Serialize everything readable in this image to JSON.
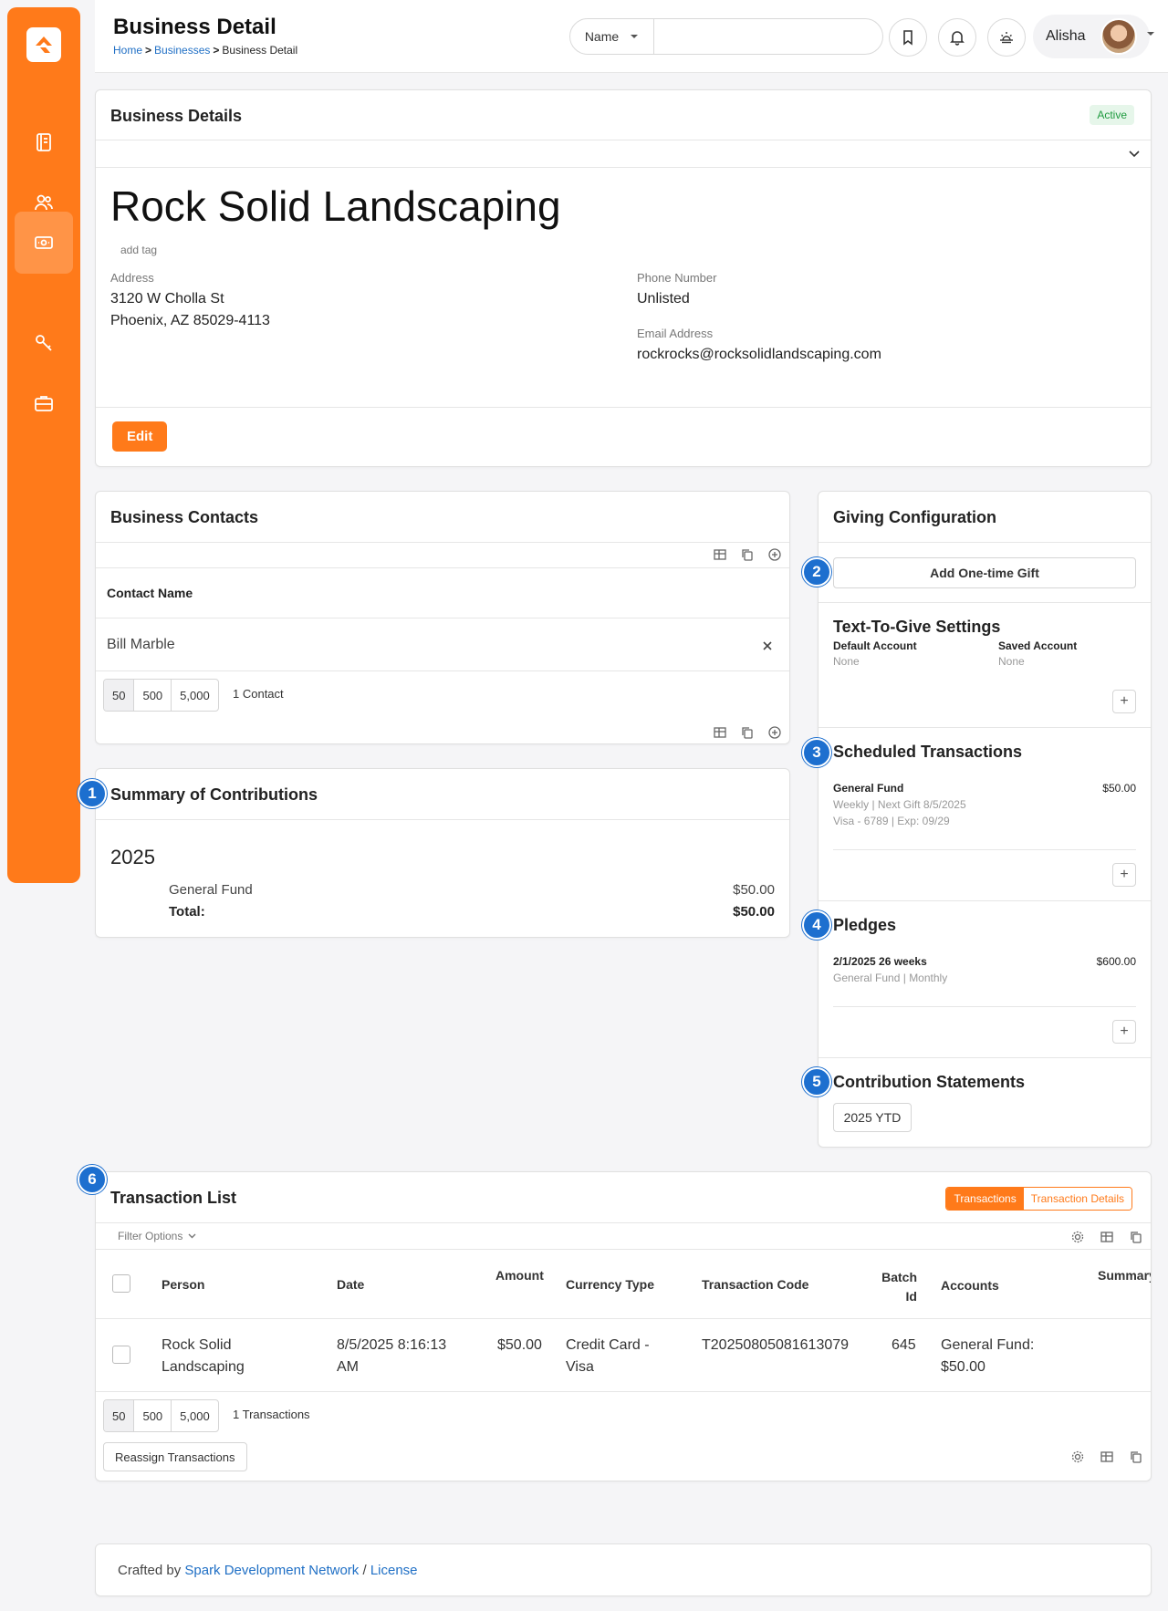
{
  "header": {
    "title": "Business Detail",
    "breadcrumb": [
      "Home",
      "Businesses",
      "Business Detail"
    ],
    "search_scope": "Name",
    "search_value": "",
    "user_name": "Alisha"
  },
  "business": {
    "card_title": "Business Details",
    "status": "Active",
    "name": "Rock Solid Landscaping",
    "add_tag": "add tag",
    "address_label": "Address",
    "address_line1": "3120 W Cholla St",
    "address_line2": "Phoenix, AZ 85029-4113",
    "phone_label": "Phone Number",
    "phone_value": "Unlisted",
    "email_label": "Email Address",
    "email_value": "rockrocks@rocksolidlandscaping.com",
    "edit_label": "Edit"
  },
  "contacts": {
    "title": "Business Contacts",
    "column": "Contact Name",
    "rows": [
      {
        "name": "Bill Marble"
      }
    ],
    "pager": [
      "50",
      "500",
      "5,000"
    ],
    "count": "1 Contact"
  },
  "summary": {
    "title": "Summary of Contributions",
    "year": "2025",
    "fund": "General Fund",
    "fund_amount": "$50.00",
    "total_label": "Total:",
    "total_amount": "$50.00"
  },
  "giving": {
    "title": "Giving Configuration",
    "add_gift": "Add One-time Gift",
    "ttg_title": "Text-To-Give Settings",
    "default_account_label": "Default Account",
    "default_account_value": "None",
    "saved_account_label": "Saved Account",
    "saved_account_value": "None",
    "scheduled_title": "Scheduled Transactions",
    "scheduled_fund": "General Fund",
    "scheduled_amount": "$50.00",
    "scheduled_freq": "Weekly",
    "scheduled_next": "Next Gift 8/5/2025",
    "scheduled_card": "Visa - 6789",
    "scheduled_exp": "Exp: 09/29",
    "pledges_title": "Pledges",
    "pledge_desc": "2/1/2025 26 weeks",
    "pledge_amount": "$600.00",
    "pledge_fund": "General Fund",
    "pledge_freq": "Monthly",
    "statements_title": "Contribution Statements",
    "statement_btn": "2025 YTD"
  },
  "transactions": {
    "title": "Transaction List",
    "tab_on": "Transactions",
    "tab_off": "Transaction Details",
    "filter": "Filter Options",
    "columns": {
      "person": "Person",
      "date": "Date",
      "amount": "Amount",
      "currency": "Currency Type",
      "code": "Transaction Code",
      "batch_line1": "Batch",
      "batch_line2": "Id",
      "accounts": "Accounts",
      "summary": "Summary"
    },
    "rows": [
      {
        "person_l1": "Rock Solid",
        "person_l2": "Landscaping",
        "date_l1": "8/5/2025 8:16:13",
        "date_l2": "AM",
        "amount": "$50.00",
        "currency_l1": "Credit Card -",
        "currency_l2": "Visa",
        "code": "T20250805081613079",
        "batch": "645",
        "accounts_l1": "General Fund:",
        "accounts_l2": "$50.00"
      }
    ],
    "pager": [
      "50",
      "500",
      "5,000"
    ],
    "count": "1 Transactions",
    "reassign": "Reassign Transactions"
  },
  "markers": [
    "1",
    "2",
    "3",
    "4",
    "5",
    "6"
  ],
  "footer": {
    "prefix": "Crafted by",
    "link1": "Spark Development Network",
    "sep": "/",
    "link2": "License"
  },
  "colors": {
    "brand": "#ff7a1a",
    "link": "#1f6fc5",
    "marker": "#1d6fcf",
    "active_badge": "#1e9a3e"
  }
}
